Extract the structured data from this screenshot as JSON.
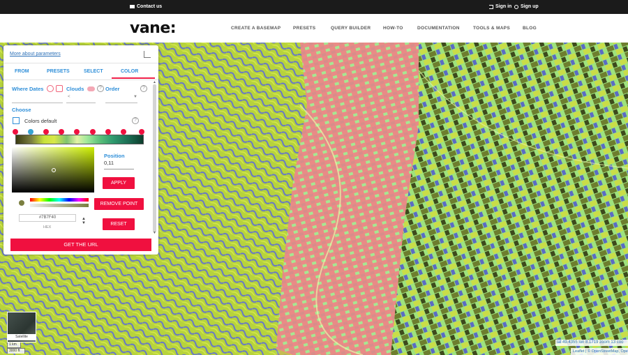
{
  "topbar": {
    "contact": "Contact us",
    "sign_in": "Sign in",
    "sign_up": "Sign up"
  },
  "header": {
    "logo": "vane:",
    "nav": [
      "CREATE A BASEMAP",
      "PRESETS",
      "QUERY BUILDER",
      "HOW-TO",
      "DOCUMENTATION",
      "TOOLS & MAPS",
      "BLOG"
    ]
  },
  "panel": {
    "more_link": "More about parameters",
    "tabs": [
      "FROM",
      "PRESETS",
      "SELECT",
      "COLOR"
    ],
    "active_tab": "COLOR",
    "where_dates": "Where Dates",
    "clouds": "Clouds",
    "order": "Order",
    "clouds_value": "<",
    "choose": "Choose",
    "colors_default": "Colors default",
    "position_label": "Position",
    "position_value": "0,11",
    "apply": "APPLY",
    "remove_point": "REMOVE POINT",
    "reset": "RESET",
    "hex_value": "#7B7F40",
    "hex_label": "HEX",
    "get_url": "GET THE URL",
    "color_points": [
      "#f0103f",
      "#37a3d3",
      "#f0103f",
      "#f0103f",
      "#f0103f",
      "#f0103f",
      "#f0103f",
      "#f0103f",
      "#f0103f"
    ],
    "accent": "#f0103f",
    "link_color": "#2f8fd9"
  },
  "map": {
    "layer_label": "Satellite",
    "scale_km": "1 km",
    "scale_ft": "3000 ft",
    "coords": "lat 49.4355 lon 8.1719 zoom 13 coo",
    "attribution": "Leaflet | © OpenStreetMap, Ope"
  }
}
